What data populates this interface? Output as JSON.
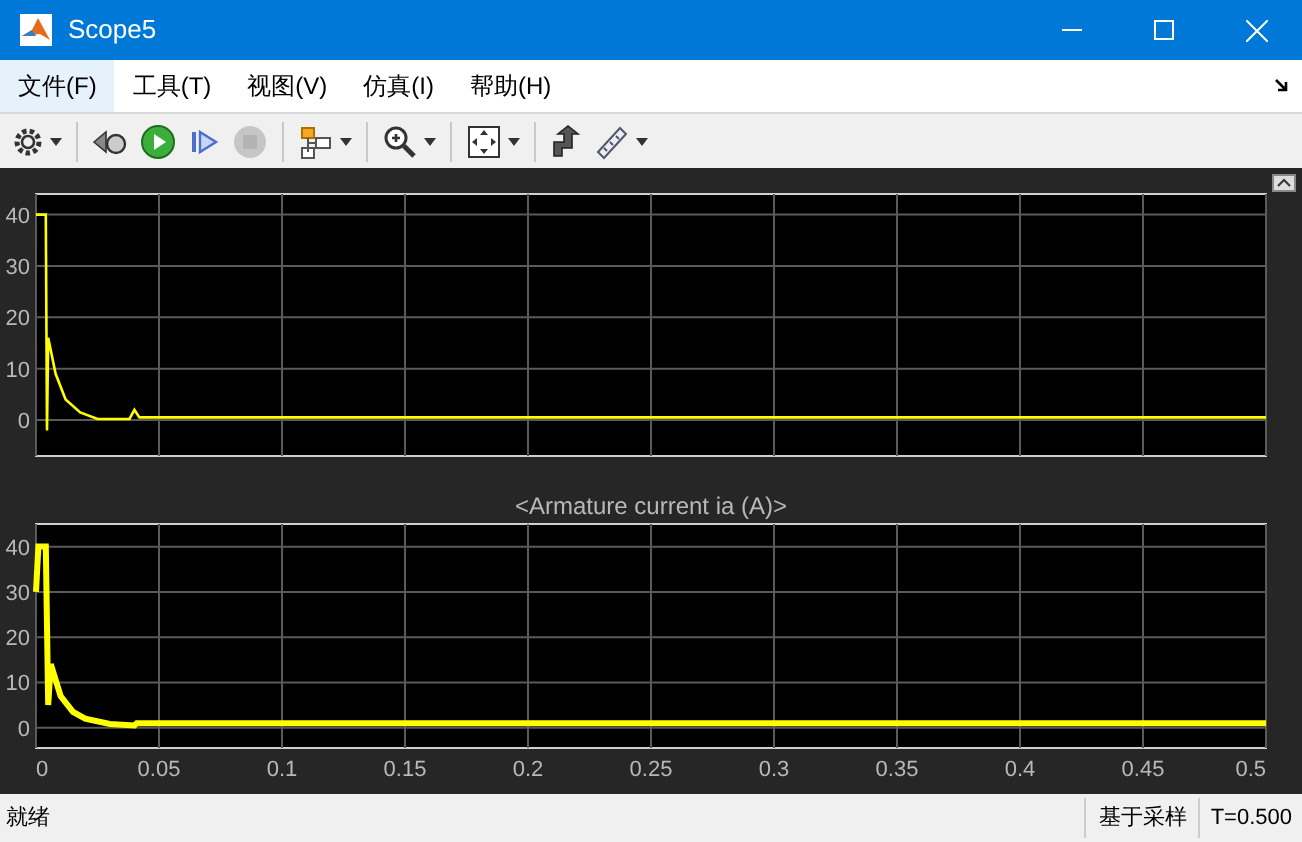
{
  "window": {
    "title": "Scope5"
  },
  "menu": [
    {
      "label": "文件(F)",
      "selected": true
    },
    {
      "label": "工具(T)",
      "selected": false
    },
    {
      "label": "视图(V)",
      "selected": false
    },
    {
      "label": "仿真(I)",
      "selected": false
    },
    {
      "label": "帮助(H)",
      "selected": false
    }
  ],
  "toolbar": [
    {
      "kind": "settings",
      "disabled": false,
      "dropdown": true
    },
    {
      "kind": "step-back",
      "disabled": false,
      "dropdown": false
    },
    {
      "kind": "run",
      "disabled": false,
      "dropdown": false
    },
    {
      "kind": "step-forward",
      "disabled": false,
      "dropdown": false
    },
    {
      "kind": "stop",
      "disabled": true,
      "dropdown": false
    },
    {
      "kind": "signals",
      "disabled": false,
      "dropdown": true
    },
    {
      "kind": "zoom",
      "disabled": false,
      "dropdown": true
    },
    {
      "kind": "fit",
      "disabled": false,
      "dropdown": true
    },
    {
      "kind": "highlight",
      "disabled": false,
      "dropdown": false
    },
    {
      "kind": "measure",
      "disabled": false,
      "dropdown": true
    }
  ],
  "plots": [
    {
      "chart_data": {
        "type": "line",
        "x": [
          0,
          0.004,
          0.0045,
          0.005,
          0.008,
          0.012,
          0.018,
          0.025,
          0.038,
          0.04,
          0.042,
          0.05,
          0.5
        ],
        "series": [
          {
            "color": "#ffff00",
            "values": [
              40,
              40,
              -2,
              16,
              9,
              4,
              1.5,
              0.2,
              0.2,
              2,
              0.5,
              0.5,
              0.5
            ]
          }
        ],
        "xlim": [
          0,
          0.5
        ],
        "ylim": [
          -7,
          44
        ],
        "yticks": [
          0,
          10,
          20,
          30,
          40
        ],
        "grid": true
      }
    },
    {
      "chart_data": {
        "type": "line",
        "title": "<Armature current ia (A)>",
        "x": [
          0,
          0.001,
          0.004,
          0.005,
          0.006,
          0.01,
          0.015,
          0.02,
          0.03,
          0.04,
          0.041,
          0.05,
          0.5
        ],
        "grid": true,
        "series": [
          {
            "color": "#ffff00",
            "values": [
              30,
              40,
              40,
              5,
              14,
              7,
              3.5,
              2,
              0.8,
              0.5,
              1,
              1,
              1
            ]
          }
        ],
        "xlim": [
          0,
          0.5
        ],
        "ylim": [
          -4.5,
          45
        ],
        "yticks": [
          0,
          10,
          20,
          30,
          40
        ],
        "xticks": [
          {
            "value": 0,
            "label": "0"
          },
          {
            "value": 0.05,
            "label": "0.05"
          },
          {
            "value": 0.1,
            "label": "0.1"
          },
          {
            "value": 0.15,
            "label": "0.15"
          },
          {
            "value": 0.2,
            "label": "0.2"
          },
          {
            "value": 0.25,
            "label": "0.25"
          },
          {
            "value": 0.3,
            "label": "0.3"
          },
          {
            "value": 0.35,
            "label": "0.35"
          },
          {
            "value": 0.4,
            "label": "0.4"
          },
          {
            "value": 0.45,
            "label": "0.45"
          },
          {
            "value": 0.5,
            "label": "0.5"
          }
        ]
      }
    }
  ],
  "status_bar": {
    "state": "就绪",
    "mode": "基于采样",
    "time": "T=0.500"
  }
}
